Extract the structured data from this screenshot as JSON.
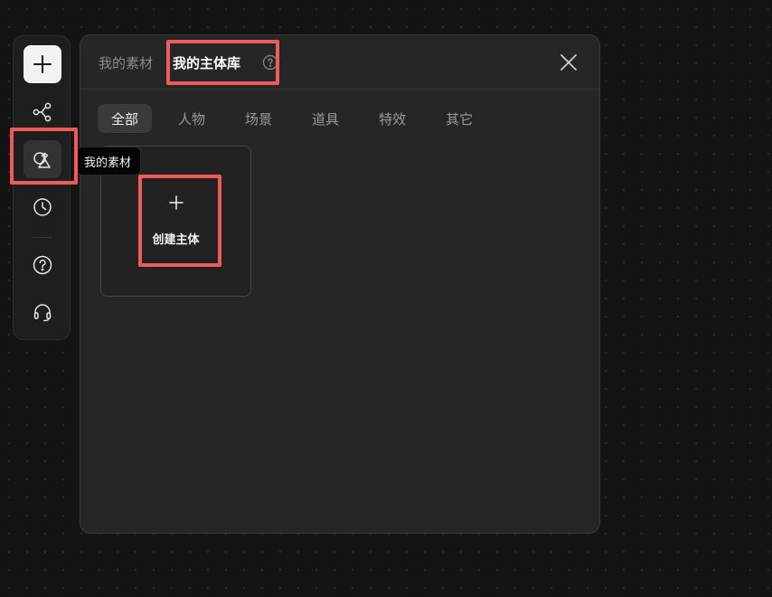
{
  "toolbar": {
    "items": [
      {
        "icon": "plus-icon"
      },
      {
        "icon": "workflow-icon"
      },
      {
        "icon": "shapes-icon"
      },
      {
        "icon": "clock-icon"
      },
      {
        "icon": "help-circle-icon"
      },
      {
        "icon": "headset-icon"
      }
    ]
  },
  "tooltip": {
    "text": "我的素材"
  },
  "panel": {
    "tabs": [
      {
        "label": "我的素材",
        "active": false
      },
      {
        "label": "我的主体库",
        "active": true
      }
    ],
    "filters": [
      {
        "label": "全部",
        "active": true
      },
      {
        "label": "人物"
      },
      {
        "label": "场景"
      },
      {
        "label": "道具"
      },
      {
        "label": "特效"
      },
      {
        "label": "其它"
      }
    ],
    "create_card": {
      "plus": "+",
      "label": "创建主体"
    }
  },
  "colors": {
    "highlight": "#f05a5a",
    "background": "#141414",
    "panel": "#262626"
  }
}
